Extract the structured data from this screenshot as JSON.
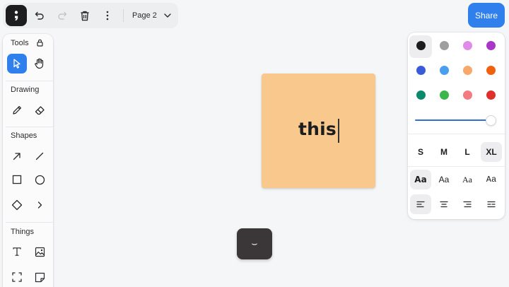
{
  "app": {
    "page_selector": {
      "label": "Page 2"
    },
    "share_label": "Share"
  },
  "toolbar": {
    "icons": [
      "menu-logo-icon",
      "undo-icon",
      "redo-icon",
      "trash-icon",
      "more-vertical-icon",
      "chevron-down-icon"
    ],
    "redo_disabled": true
  },
  "tools_panel": {
    "sections": [
      {
        "title": "Tools",
        "items": [
          "select-tool",
          "hand-tool"
        ],
        "active": "select-tool"
      },
      {
        "title": "Drawing",
        "items": [
          "pencil-tool",
          "eraser-tool"
        ]
      },
      {
        "title": "Shapes",
        "items": [
          "arrow-tool",
          "line-tool",
          "rectangle-tool",
          "ellipse-tool",
          "diamond-tool",
          "chevron-tool"
        ]
      },
      {
        "title": "Things",
        "items": [
          "text-tool",
          "image-tool",
          "frame-tool",
          "sticky-note-tool"
        ]
      }
    ]
  },
  "sticky_note": {
    "text": "this",
    "color": "#f9c88d",
    "editing": true
  },
  "style_panel": {
    "colors": [
      "#1d1d1d",
      "#9e9e9e",
      "#e08be8",
      "#a837c9",
      "#3a5bd9",
      "#4a9ef0",
      "#f7a86a",
      "#f0600e",
      "#0b8a6b",
      "#3cb54a",
      "#f27a80",
      "#e0302c"
    ],
    "selected_color": "#1d1d1d",
    "opacity": 1.0,
    "sizes": [
      "S",
      "M",
      "L",
      "XL"
    ],
    "selected_size": "XL",
    "font_samples": [
      "Aa",
      "Aa",
      "Aa",
      "Aa"
    ],
    "selected_font_index": 0,
    "alignments": [
      "align-left-icon",
      "align-center-icon",
      "align-right-icon",
      "align-justify-icon"
    ],
    "selected_alignment": "align-left-icon"
  },
  "help_button": {
    "glyph": "⌣"
  },
  "accent_color": "#2f80ed"
}
